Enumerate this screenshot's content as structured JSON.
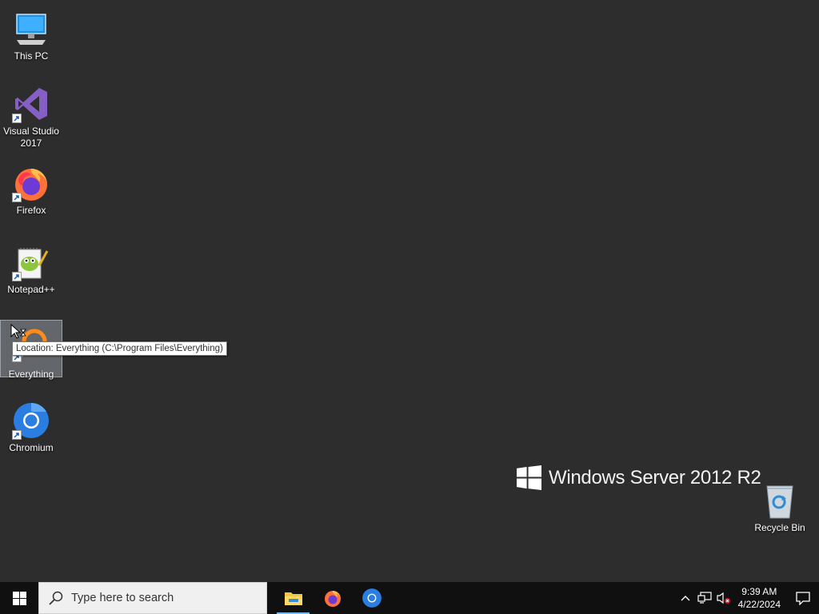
{
  "desktop": {
    "icons": [
      {
        "label": "This PC"
      },
      {
        "label": "Visual Studio 2017"
      },
      {
        "label": "Firefox"
      },
      {
        "label": "Notepad++"
      },
      {
        "label": "Everything"
      },
      {
        "label": "Chromium"
      },
      {
        "label": "Recycle Bin"
      }
    ],
    "tooltip": "Location: Everything (C:\\Program Files\\Everything)",
    "watermark": "Windows Server 2012 R2"
  },
  "taskbar": {
    "search_placeholder": "Type here to search",
    "apps": [
      "File Explorer",
      "Firefox",
      "Chromium"
    ],
    "clock_time": "9:39 AM",
    "clock_date": "4/22/2024"
  },
  "colors": {
    "desktop_bg": "#2d2d2d",
    "taskbar_bg": "#101010",
    "active_indicator": "#76b9ed"
  }
}
